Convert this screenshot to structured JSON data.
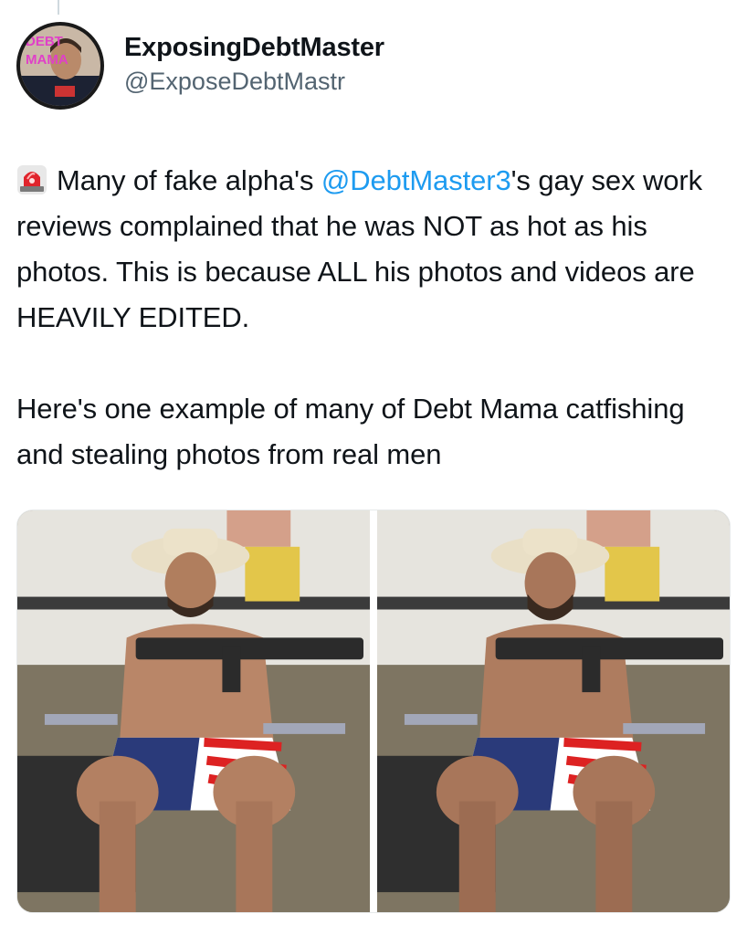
{
  "author": {
    "display_name": "ExposingDebtMaster",
    "handle": "@ExposeDebtMastr",
    "avatar_text": "DEBT MAMA"
  },
  "tweet": {
    "emoji": "siren-icon",
    "para1_before": "Many of fake alpha's ",
    "mention": "@DebtMaster3",
    "para1_after": "'s gay sex work reviews complained that he was NOT as hot as his photos. This is because ALL his photos and videos are HEAVILY EDITED.",
    "para2": "Here's one example of many of Debt Mama catfishing and stealing photos from real men"
  },
  "colors": {
    "mention": "#1d9bf0",
    "handle": "#536471"
  },
  "media": {
    "count": 2
  }
}
